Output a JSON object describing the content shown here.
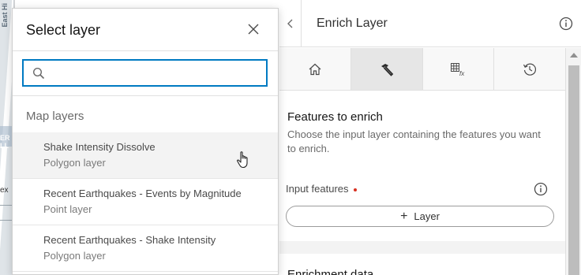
{
  "map": {
    "labels": [
      "East Hi",
      "ER LL",
      "ex"
    ]
  },
  "panel": {
    "title": "Enrich Layer",
    "back_icon": "chevron-left-icon",
    "info_icon": "information-icon",
    "tabs": [
      {
        "icon": "home-icon",
        "active": false
      },
      {
        "icon": "hammer-icon",
        "active": true
      },
      {
        "icon": "table-fx-icon",
        "active": false
      },
      {
        "icon": "history-icon",
        "active": false
      }
    ]
  },
  "section": {
    "title": "Features to enrich",
    "description": "Choose the input layer containing the features you want to enrich.",
    "field_label": "Input features",
    "button_label": "Layer"
  },
  "section2": {
    "title": "Enrichment data"
  },
  "popover": {
    "title": "Select layer",
    "search": {
      "value": "",
      "placeholder": ""
    },
    "group_label": "Map layers",
    "items": [
      {
        "name": "Shake Intensity Dissolve",
        "type": "Polygon layer"
      },
      {
        "name": "Recent Earthquakes - Events by Magnitude",
        "type": "Point layer"
      },
      {
        "name": "Recent Earthquakes - Shake Intensity",
        "type": "Polygon layer"
      }
    ]
  },
  "colors": {
    "accent": "#007ac2",
    "required": "#d83020"
  }
}
